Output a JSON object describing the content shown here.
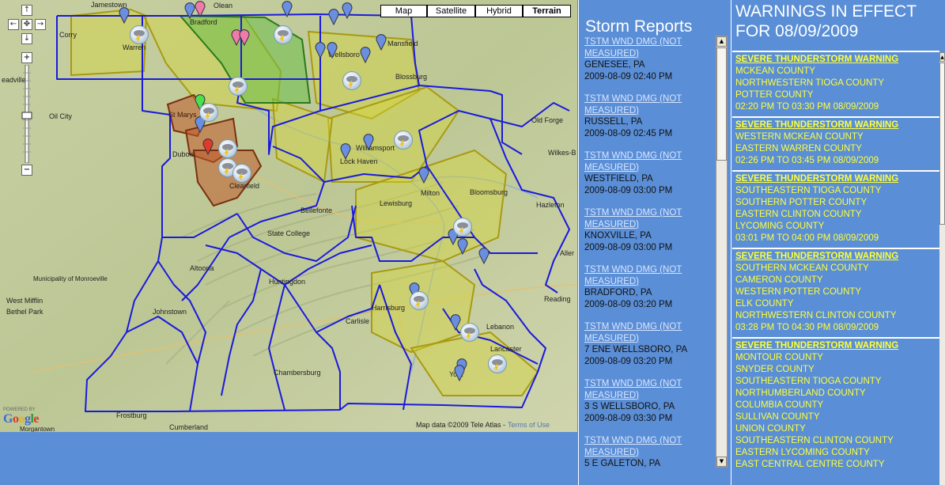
{
  "map": {
    "map_types": [
      {
        "label": "Map",
        "active": false
      },
      {
        "label": "Satellite",
        "active": false
      },
      {
        "label": "Hybrid",
        "active": false
      },
      {
        "label": "Terrain",
        "active": true
      }
    ],
    "attribution": "Map data ©2009 Tele Atlas -",
    "terms_link": "Terms of Use",
    "powered_by": "POWERED BY",
    "logo": "Google",
    "towns": [
      "Jamestown",
      "Olean",
      "Corry",
      "Bradford",
      "Warren",
      "Mansfield",
      "Wellsboro",
      "Blossburg",
      "Oil City",
      "Old Forge",
      "Wilkes-B",
      "Williamsport",
      "Lock Haven",
      "Dubois",
      "Milton",
      "Bloomsburg",
      "Lewisburg",
      "Hazleton",
      "Bellefonte",
      "State College",
      "Aller",
      "Altoona",
      "Municipality of Monroeville",
      "West Mifflin",
      "Bethel Park",
      "Huntingdon",
      "Johnstown",
      "Harrisburg",
      "Reading",
      "Carlisle",
      "Lebanon",
      "Lancaster",
      "Chambersburg",
      "York",
      "Frostburg",
      "Cumberland",
      "Morgantown",
      "St Marys",
      "eadville",
      "Clearfield"
    ]
  },
  "storm": {
    "title": "Storm Reports",
    "reports": [
      {
        "type": "TSTM WND DMG (NOT MEASURED)",
        "location": "GENESEE, PA",
        "time": "2009-08-09 02:40 PM"
      },
      {
        "type": "TSTM WND DMG (NOT MEASURED)",
        "location": "RUSSELL, PA",
        "time": "2009-08-09 02:45 PM"
      },
      {
        "type": "TSTM WND DMG (NOT MEASURED)",
        "location": "WESTFIELD, PA",
        "time": "2009-08-09 03:00 PM"
      },
      {
        "type": "TSTM WND DMG (NOT MEASURED)",
        "location": "KNOXVILLE, PA",
        "time": "2009-08-09 03:00 PM"
      },
      {
        "type": "TSTM WND DMG (NOT MEASURED)",
        "location": "BRADFORD, PA",
        "time": "2009-08-09 03:20 PM"
      },
      {
        "type": "TSTM WND DMG (NOT MEASURED)",
        "location": "7 ENE WELLSBORO, PA",
        "time": "2009-08-09 03:20 PM"
      },
      {
        "type": "TSTM WND DMG (NOT MEASURED)",
        "location": "3 S WELLSBORO, PA",
        "time": "2009-08-09 03:30 PM"
      },
      {
        "type": "TSTM WND DMG (NOT MEASURED)",
        "location": "5 E GALETON, PA",
        "time": ""
      }
    ]
  },
  "warnings": {
    "title": "WARNINGS IN EFFECT FOR 08/09/2009",
    "items": [
      {
        "type": "SEVERE THUNDERSTORM WARNING",
        "counties": [
          "MCKEAN COUNTY",
          "NORTHWESTERN TIOGA COUNTY",
          "POTTER COUNTY"
        ],
        "time": "02:20 PM TO 03:30 PM 08/09/2009"
      },
      {
        "type": "SEVERE THUNDERSTORM WARNING",
        "counties": [
          "WESTERN MCKEAN COUNTY",
          "EASTERN WARREN COUNTY"
        ],
        "time": "02:26 PM TO 03:45 PM 08/09/2009"
      },
      {
        "type": "SEVERE THUNDERSTORM WARNING",
        "counties": [
          "SOUTHEASTERN TIOGA COUNTY",
          "SOUTHERN POTTER COUNTY",
          "EASTERN CLINTON COUNTY",
          "LYCOMING COUNTY"
        ],
        "time": "03:01 PM TO 04:00 PM 08/09/2009"
      },
      {
        "type": "SEVERE THUNDERSTORM WARNING",
        "counties": [
          "SOUTHERN MCKEAN COUNTY",
          "CAMERON COUNTY",
          "WESTERN POTTER COUNTY",
          "ELK COUNTY",
          "NORTHWESTERN CLINTON COUNTY"
        ],
        "time": "03:28 PM TO 04:30 PM 08/09/2009"
      },
      {
        "type": "SEVERE THUNDERSTORM WARNING",
        "counties": [
          "MONTOUR COUNTY",
          "SNYDER COUNTY",
          "SOUTHEASTERN TIOGA COUNTY",
          "NORTHUMBERLAND COUNTY",
          "COLUMBIA COUNTY",
          "SULLIVAN COUNTY",
          "UNION COUNTY",
          "SOUTHEASTERN CLINTON COUNTY",
          "EASTERN LYCOMING COUNTY",
          "EAST CENTRAL CENTRE COUNTY"
        ],
        "time": ""
      }
    ]
  },
  "colors": {
    "panel_bg": "#5a8ed6",
    "warning_text": "#ffff3a",
    "county_border": "#1a1adc",
    "severe_warning_fill": "#d4d43a",
    "tornado_warning_fill": "#8b3a1a",
    "green_box_fill": "#6cc04a"
  }
}
